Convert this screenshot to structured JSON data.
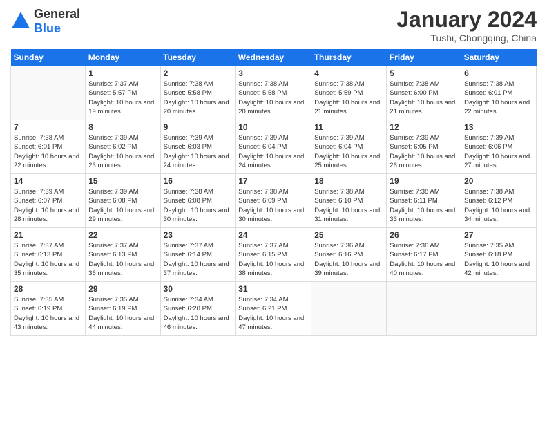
{
  "header": {
    "logo_general": "General",
    "logo_blue": "Blue",
    "month_title": "January 2024",
    "subtitle": "Tushi, Chongqing, China"
  },
  "days_of_week": [
    "Sunday",
    "Monday",
    "Tuesday",
    "Wednesday",
    "Thursday",
    "Friday",
    "Saturday"
  ],
  "weeks": [
    [
      {
        "day": "",
        "sunrise": "",
        "sunset": "",
        "daylight": "",
        "empty": true
      },
      {
        "day": "1",
        "sunrise": "Sunrise: 7:37 AM",
        "sunset": "Sunset: 5:57 PM",
        "daylight": "Daylight: 10 hours and 19 minutes."
      },
      {
        "day": "2",
        "sunrise": "Sunrise: 7:38 AM",
        "sunset": "Sunset: 5:58 PM",
        "daylight": "Daylight: 10 hours and 20 minutes."
      },
      {
        "day": "3",
        "sunrise": "Sunrise: 7:38 AM",
        "sunset": "Sunset: 5:58 PM",
        "daylight": "Daylight: 10 hours and 20 minutes."
      },
      {
        "day": "4",
        "sunrise": "Sunrise: 7:38 AM",
        "sunset": "Sunset: 5:59 PM",
        "daylight": "Daylight: 10 hours and 21 minutes."
      },
      {
        "day": "5",
        "sunrise": "Sunrise: 7:38 AM",
        "sunset": "Sunset: 6:00 PM",
        "daylight": "Daylight: 10 hours and 21 minutes."
      },
      {
        "day": "6",
        "sunrise": "Sunrise: 7:38 AM",
        "sunset": "Sunset: 6:01 PM",
        "daylight": "Daylight: 10 hours and 22 minutes."
      }
    ],
    [
      {
        "day": "7",
        "sunrise": "Sunrise: 7:38 AM",
        "sunset": "Sunset: 6:01 PM",
        "daylight": "Daylight: 10 hours and 22 minutes."
      },
      {
        "day": "8",
        "sunrise": "Sunrise: 7:39 AM",
        "sunset": "Sunset: 6:02 PM",
        "daylight": "Daylight: 10 hours and 23 minutes."
      },
      {
        "day": "9",
        "sunrise": "Sunrise: 7:39 AM",
        "sunset": "Sunset: 6:03 PM",
        "daylight": "Daylight: 10 hours and 24 minutes."
      },
      {
        "day": "10",
        "sunrise": "Sunrise: 7:39 AM",
        "sunset": "Sunset: 6:04 PM",
        "daylight": "Daylight: 10 hours and 24 minutes."
      },
      {
        "day": "11",
        "sunrise": "Sunrise: 7:39 AM",
        "sunset": "Sunset: 6:04 PM",
        "daylight": "Daylight: 10 hours and 25 minutes."
      },
      {
        "day": "12",
        "sunrise": "Sunrise: 7:39 AM",
        "sunset": "Sunset: 6:05 PM",
        "daylight": "Daylight: 10 hours and 26 minutes."
      },
      {
        "day": "13",
        "sunrise": "Sunrise: 7:39 AM",
        "sunset": "Sunset: 6:06 PM",
        "daylight": "Daylight: 10 hours and 27 minutes."
      }
    ],
    [
      {
        "day": "14",
        "sunrise": "Sunrise: 7:39 AM",
        "sunset": "Sunset: 6:07 PM",
        "daylight": "Daylight: 10 hours and 28 minutes."
      },
      {
        "day": "15",
        "sunrise": "Sunrise: 7:39 AM",
        "sunset": "Sunset: 6:08 PM",
        "daylight": "Daylight: 10 hours and 29 minutes."
      },
      {
        "day": "16",
        "sunrise": "Sunrise: 7:38 AM",
        "sunset": "Sunset: 6:08 PM",
        "daylight": "Daylight: 10 hours and 30 minutes."
      },
      {
        "day": "17",
        "sunrise": "Sunrise: 7:38 AM",
        "sunset": "Sunset: 6:09 PM",
        "daylight": "Daylight: 10 hours and 30 minutes."
      },
      {
        "day": "18",
        "sunrise": "Sunrise: 7:38 AM",
        "sunset": "Sunset: 6:10 PM",
        "daylight": "Daylight: 10 hours and 31 minutes."
      },
      {
        "day": "19",
        "sunrise": "Sunrise: 7:38 AM",
        "sunset": "Sunset: 6:11 PM",
        "daylight": "Daylight: 10 hours and 33 minutes."
      },
      {
        "day": "20",
        "sunrise": "Sunrise: 7:38 AM",
        "sunset": "Sunset: 6:12 PM",
        "daylight": "Daylight: 10 hours and 34 minutes."
      }
    ],
    [
      {
        "day": "21",
        "sunrise": "Sunrise: 7:37 AM",
        "sunset": "Sunset: 6:13 PM",
        "daylight": "Daylight: 10 hours and 35 minutes."
      },
      {
        "day": "22",
        "sunrise": "Sunrise: 7:37 AM",
        "sunset": "Sunset: 6:13 PM",
        "daylight": "Daylight: 10 hours and 36 minutes."
      },
      {
        "day": "23",
        "sunrise": "Sunrise: 7:37 AM",
        "sunset": "Sunset: 6:14 PM",
        "daylight": "Daylight: 10 hours and 37 minutes."
      },
      {
        "day": "24",
        "sunrise": "Sunrise: 7:37 AM",
        "sunset": "Sunset: 6:15 PM",
        "daylight": "Daylight: 10 hours and 38 minutes."
      },
      {
        "day": "25",
        "sunrise": "Sunrise: 7:36 AM",
        "sunset": "Sunset: 6:16 PM",
        "daylight": "Daylight: 10 hours and 39 minutes."
      },
      {
        "day": "26",
        "sunrise": "Sunrise: 7:36 AM",
        "sunset": "Sunset: 6:17 PM",
        "daylight": "Daylight: 10 hours and 40 minutes."
      },
      {
        "day": "27",
        "sunrise": "Sunrise: 7:35 AM",
        "sunset": "Sunset: 6:18 PM",
        "daylight": "Daylight: 10 hours and 42 minutes."
      }
    ],
    [
      {
        "day": "28",
        "sunrise": "Sunrise: 7:35 AM",
        "sunset": "Sunset: 6:19 PM",
        "daylight": "Daylight: 10 hours and 43 minutes."
      },
      {
        "day": "29",
        "sunrise": "Sunrise: 7:35 AM",
        "sunset": "Sunset: 6:19 PM",
        "daylight": "Daylight: 10 hours and 44 minutes."
      },
      {
        "day": "30",
        "sunrise": "Sunrise: 7:34 AM",
        "sunset": "Sunset: 6:20 PM",
        "daylight": "Daylight: 10 hours and 46 minutes."
      },
      {
        "day": "31",
        "sunrise": "Sunrise: 7:34 AM",
        "sunset": "Sunset: 6:21 PM",
        "daylight": "Daylight: 10 hours and 47 minutes."
      },
      {
        "day": "",
        "sunrise": "",
        "sunset": "",
        "daylight": "",
        "empty": true
      },
      {
        "day": "",
        "sunrise": "",
        "sunset": "",
        "daylight": "",
        "empty": true
      },
      {
        "day": "",
        "sunrise": "",
        "sunset": "",
        "daylight": "",
        "empty": true
      }
    ]
  ]
}
